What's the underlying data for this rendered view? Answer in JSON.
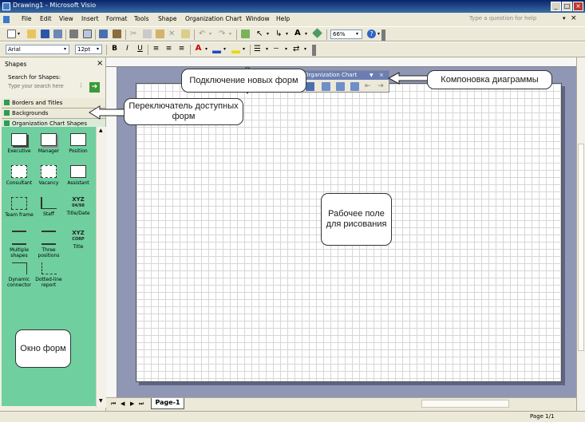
{
  "window": {
    "title": "Drawing1 - Microsoft Visio",
    "minimize": "_",
    "maximize": "□",
    "close": "×"
  },
  "menu": {
    "items": [
      "File",
      "Edit",
      "View",
      "Insert",
      "Format",
      "Tools",
      "Shape",
      "Organization Chart",
      "Window",
      "Help"
    ],
    "help_placeholder": "Type a question for help"
  },
  "toolbar": {
    "zoom": "66%",
    "font": "Arial",
    "size": "12pt",
    "bold": "B",
    "italic": "I",
    "underline": "U",
    "font_color_letter": "A"
  },
  "shapes_pane": {
    "title": "Shapes",
    "close": "×",
    "search_label": "Search for Shapes:",
    "search_placeholder": "Type your search here",
    "search_go": "➔",
    "stencils": [
      "Borders and Titles",
      "Backgrounds",
      "Organization Chart Shapes"
    ],
    "shapes": [
      {
        "label": "Executive",
        "icon": "executive-shape-icon"
      },
      {
        "label": "Manager",
        "icon": "manager-shape-icon"
      },
      {
        "label": "Position",
        "icon": "position-shape-icon"
      },
      {
        "label": "Consultant",
        "icon": "consultant-shape-icon"
      },
      {
        "label": "Vacancy",
        "icon": "vacancy-shape-icon"
      },
      {
        "label": "Assistant",
        "icon": "assistant-shape-icon"
      },
      {
        "label": "Team frame",
        "icon": "team-frame-shape-icon"
      },
      {
        "label": "Staff",
        "icon": "staff-shape-icon"
      },
      {
        "label": "Title/Date",
        "icon": "title-date-shape-icon",
        "glyph": "XYZ",
        "subglyph": "04/98"
      },
      {
        "label": "Multiple shapes",
        "icon": "multiple-shapes-icon"
      },
      {
        "label": "Three positions",
        "icon": "three-positions-icon"
      },
      {
        "label": "Title",
        "icon": "title-shape-icon",
        "glyph": "XYZ",
        "subglyph": "CORP"
      },
      {
        "label": "Dynamic connector",
        "icon": "dynamic-connector-icon"
      },
      {
        "label": "Dotted-line report",
        "icon": "dotted-line-report-icon"
      }
    ]
  },
  "org_toolbar": {
    "title": "Organization Chart",
    "close": "×"
  },
  "drawing": {
    "page_tab": "Page-1"
  },
  "status": {
    "page": "Page 1/1"
  },
  "callouts": {
    "add_shapes": "Подключение новых форм",
    "layout": "Компоновка диаграммы",
    "switcher": "Переключатель доступных форм",
    "canvas": "Рабочее поле для рисования",
    "shapes_window": "Окно форм"
  }
}
